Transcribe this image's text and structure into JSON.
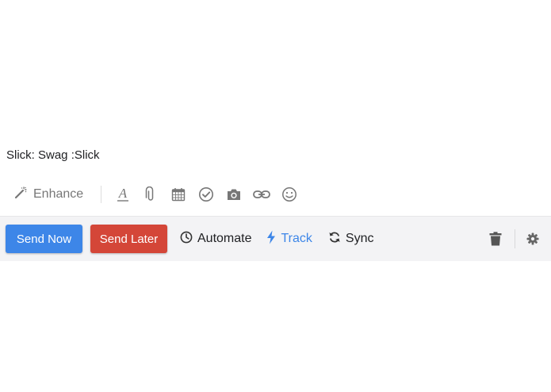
{
  "compose": {
    "body_text": "Slick: Swag :Slick"
  },
  "format_toolbar": {
    "enhance_label": "Enhance",
    "icons": [
      "magic-wand-icon",
      "font-color-icon",
      "attachment-icon",
      "calendar-icon",
      "check-circle-icon",
      "camera-icon",
      "link-icon",
      "emoji-icon"
    ]
  },
  "action_bar": {
    "send_now_label": "Send Now",
    "send_later_label": "Send Later",
    "automate_label": "Automate",
    "track_label": "Track",
    "sync_label": "Sync",
    "icons": [
      "clock-icon",
      "lightning-icon",
      "sync-icon",
      "trash-icon",
      "gear-icon"
    ]
  },
  "colors": {
    "send_now": "#3d86e8",
    "send_later": "#d44638",
    "track": "#3d86e8",
    "bar_background": "#f3f3f5",
    "icon_gray": "#777777"
  }
}
